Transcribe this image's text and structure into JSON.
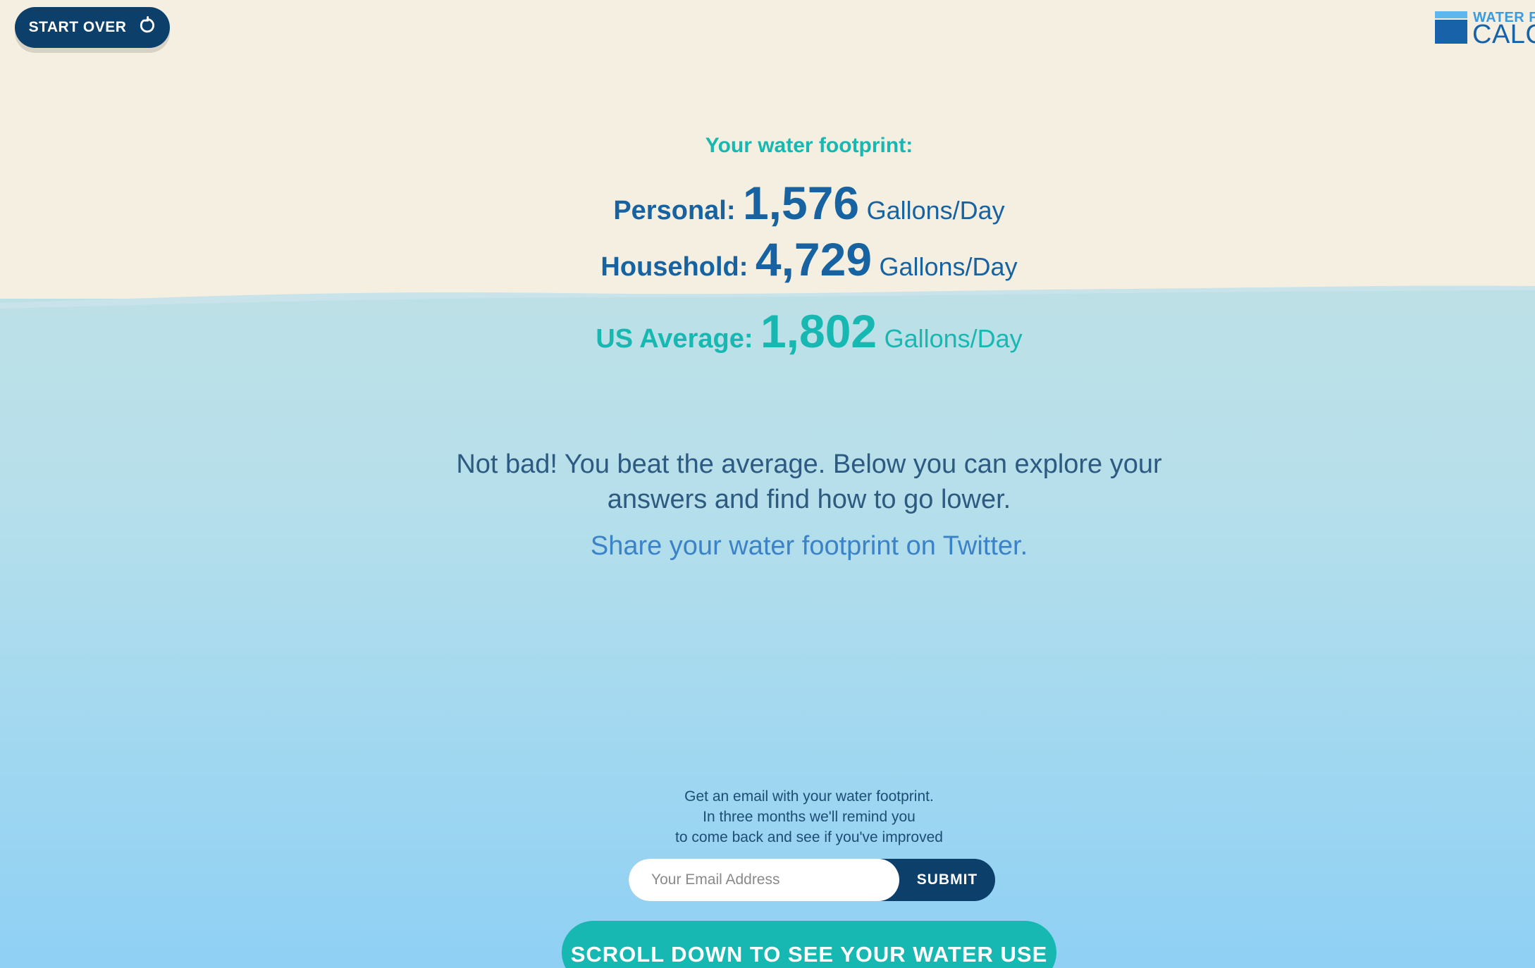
{
  "header": {
    "start_over_label": "START OVER",
    "logo_top": "WATER F",
    "logo_bottom": "CALCU"
  },
  "results": {
    "heading": "Your water footprint:",
    "personal": {
      "label": "Personal:",
      "value": "1,576",
      "unit": "Gallons/Day"
    },
    "household": {
      "label": "Household:",
      "value": "4,729",
      "unit": "Gallons/Day"
    },
    "us_average": {
      "label": "US Average:",
      "value": "1,802",
      "unit": "Gallons/Day"
    }
  },
  "message": {
    "line1": "Not bad! You beat the average. Below you can explore your",
    "line2": "answers and find how to go lower.",
    "share_link": "Share your water footprint on Twitter",
    "share_trailing": "."
  },
  "email": {
    "line1": "Get an email with your water footprint.",
    "line2": "In three months we'll remind you",
    "line3": "to come back and see if you've improved",
    "placeholder": "Your Email Address",
    "value": "",
    "submit_label": "SUBMIT"
  },
  "scroll_button_label": "SCROLL DOWN TO SEE YOUR WATER USE",
  "colors": {
    "sand": "#f5efe1",
    "navy": "#0c3f6a",
    "teal": "#17b8b1",
    "blue": "#1762a0",
    "link": "#3c82c7"
  },
  "icons": {
    "start_over": "refresh-icon",
    "logo": "water-calculator-logo"
  }
}
